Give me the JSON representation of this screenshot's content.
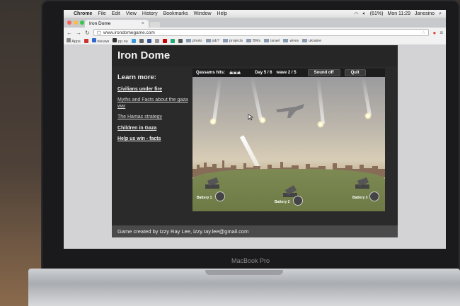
{
  "menubar": {
    "app": "Chrome",
    "items": [
      "File",
      "Edit",
      "View",
      "History",
      "Bookmarks",
      "Window",
      "Help"
    ],
    "clock": "Mon 11:29",
    "user": "Janosino",
    "battery": "(61%)"
  },
  "browser": {
    "tab_title": "Iron Dome",
    "url": "www.irondomegame.com",
    "bookmarks": [
      "Apps",
      "nieuws",
      "pp.nu",
      "photo",
      "job?",
      "projects",
      "BMs",
      "israel",
      "wires",
      "ukraine"
    ]
  },
  "site": {
    "title": "Iron Dome",
    "sidebar_heading": "Learn more:",
    "links": [
      "Civilians under fire",
      "Myths and Facts about the gaza war",
      "The Hamas strategy",
      "Children in Gaza",
      "Help us win - facts"
    ],
    "footer": "Game created by Izzy Ray Lee, izzy.ray.lee@gmail.com"
  },
  "game": {
    "hits_label": "Qassams hits:",
    "day": "Day 5 / 6",
    "wave": "wave 2 / 5",
    "sound_button": "Sound off",
    "quit_button": "Quit",
    "batteries": [
      "Battery 1",
      "Battery 2",
      "Battery 3"
    ]
  },
  "device": {
    "brand": "MacBook Pro"
  },
  "colors": {
    "site_bg": "#2a2a2a",
    "ground": "#7d8a54",
    "sky": "#9b9b9e"
  }
}
